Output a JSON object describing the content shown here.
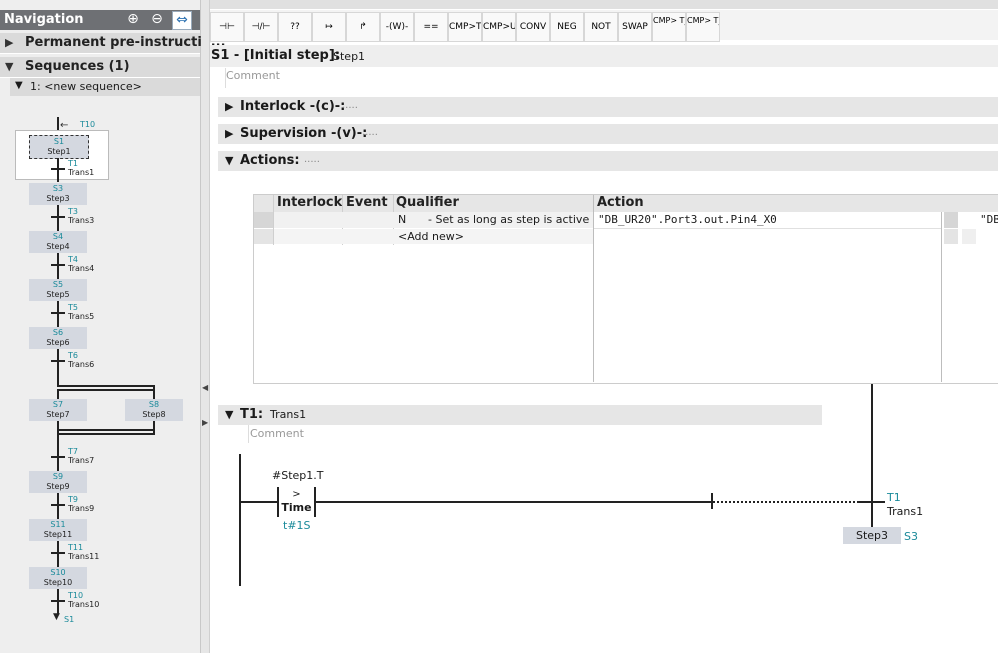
{
  "navigation": {
    "title": "Navigation",
    "tools": [
      "zoom-in-icon",
      "zoom-out-icon",
      "fit-icon"
    ],
    "permanent_label": "Permanent pre-instructio...",
    "sequences_label": "Sequences (1)",
    "sequence_item": "1: <new sequence>"
  },
  "sequence": {
    "top_transition": "T10",
    "end_target": "S1",
    "steps": [
      {
        "num": "S1",
        "name": "Step1"
      },
      {
        "num": "S3",
        "name": "Step3"
      },
      {
        "num": "S4",
        "name": "Step4"
      },
      {
        "num": "S5",
        "name": "Step5"
      },
      {
        "num": "S6",
        "name": "Step6"
      },
      {
        "num": "S7",
        "name": "Step7"
      },
      {
        "num": "S8",
        "name": "Step8"
      },
      {
        "num": "S9",
        "name": "Step9"
      },
      {
        "num": "S11",
        "name": "Step11"
      },
      {
        "num": "S10",
        "name": "Step10"
      }
    ],
    "transitions": [
      {
        "num": "T1",
        "name": "Trans1"
      },
      {
        "num": "T3",
        "name": "Trans3"
      },
      {
        "num": "T4",
        "name": "Trans4"
      },
      {
        "num": "T5",
        "name": "Trans5"
      },
      {
        "num": "T6",
        "name": "Trans6"
      },
      {
        "num": "T7",
        "name": "Trans7"
      },
      {
        "num": "T9",
        "name": "Trans9"
      },
      {
        "num": "T11",
        "name": "Trans11"
      },
      {
        "num": "T10",
        "name": "Trans10"
      }
    ]
  },
  "toolbar": {
    "buttons": [
      "⊣⊢",
      "⊣/⊢",
      "??",
      "↦",
      "↱",
      "-(W)-",
      "==",
      "CMP>T",
      "CMP>U",
      "CONV",
      "NEG",
      "NOT",
      "SWAP",
      "CMP> T_MAX",
      "CMP> T_WARN"
    ]
  },
  "step_header": {
    "prefix": "S1 - [Initial step]:",
    "name": "Step1",
    "comment": "Comment"
  },
  "sections": {
    "interlock": "Interlock -(c)-:",
    "supervision": "Supervision -(v)-:",
    "actions": "Actions:",
    "dots": "....."
  },
  "action_table": {
    "headers": {
      "interlock": "Interlock",
      "event": "Event",
      "qualifier": "Qualifier",
      "action": "Action"
    },
    "row1": {
      "qualifier_code": "N",
      "qualifier_desc": "- Set as long as step is active",
      "action": "\"DB_UR20\".Port3.out.Pin4_X0",
      "right": "\"DB"
    },
    "add_new": "<Add new>"
  },
  "transition": {
    "header_num": "T1:",
    "header_name": "Trans1",
    "comment": "Comment",
    "operand": "#Step1.T",
    "box_top": ">",
    "box_name": "Time",
    "param": "t#1S",
    "coil_num": "T1",
    "coil_name": "Trans1",
    "next_step_name": "Step3",
    "next_step_num": "S3"
  }
}
